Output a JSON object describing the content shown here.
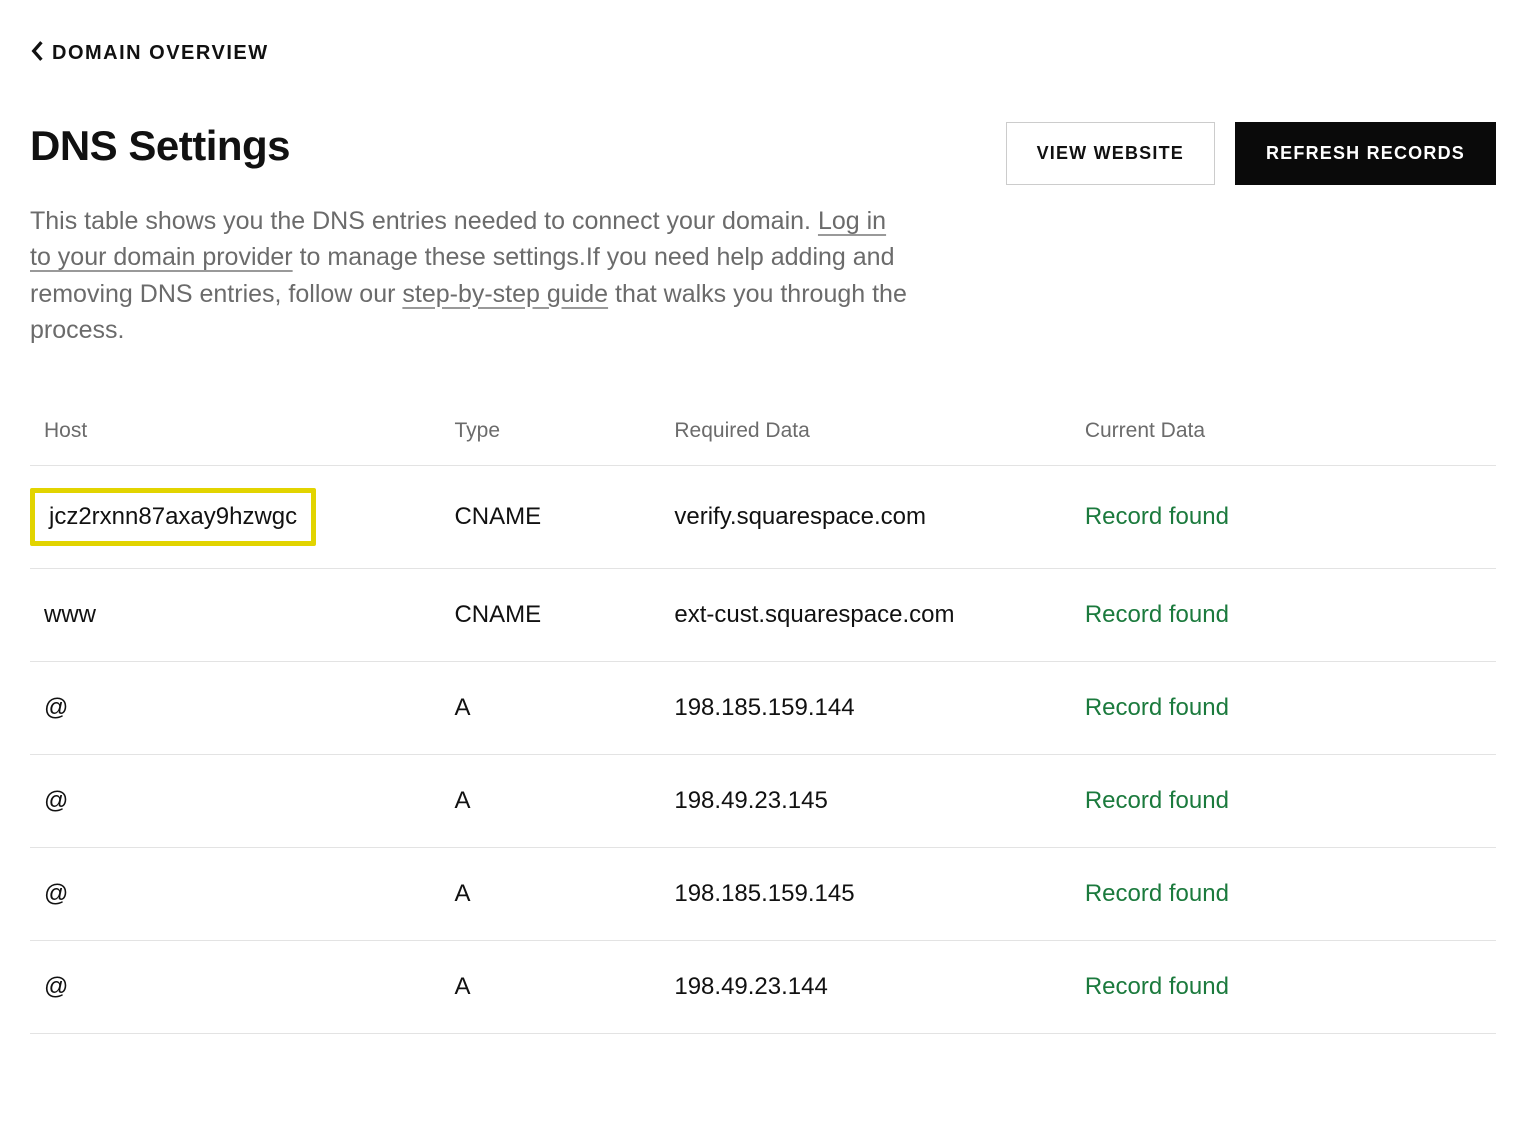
{
  "breadcrumb": {
    "label": "DOMAIN OVERVIEW"
  },
  "header": {
    "title": "DNS Settings",
    "view_website_label": "VIEW WEBSITE",
    "refresh_records_label": "REFRESH RECORDS"
  },
  "description": {
    "text_1": "This table shows you the DNS entries needed to connect your domain. ",
    "link_1": "Log in to your domain provider",
    "text_2": " to manage these settings.If you need help adding and removing DNS entries, follow our ",
    "link_2": "step-by-step guide",
    "text_3": " that walks you through the process."
  },
  "table": {
    "headers": {
      "host": "Host",
      "type": "Type",
      "required_data": "Required Data",
      "current_data": "Current Data"
    },
    "rows": [
      {
        "host": "jcz2rxnn87axay9hzwgc",
        "type": "CNAME",
        "required": "verify.squarespace.com",
        "current": "Record found",
        "highlighted": true
      },
      {
        "host": "www",
        "type": "CNAME",
        "required": "ext-cust.squarespace.com",
        "current": "Record found",
        "highlighted": false
      },
      {
        "host": "@",
        "type": "A",
        "required": "198.185.159.144",
        "current": "Record found",
        "highlighted": false
      },
      {
        "host": "@",
        "type": "A",
        "required": "198.49.23.145",
        "current": "Record found",
        "highlighted": false
      },
      {
        "host": "@",
        "type": "A",
        "required": "198.185.159.145",
        "current": "Record found",
        "highlighted": false
      },
      {
        "host": "@",
        "type": "A",
        "required": "198.49.23.144",
        "current": "Record found",
        "highlighted": false
      }
    ]
  }
}
